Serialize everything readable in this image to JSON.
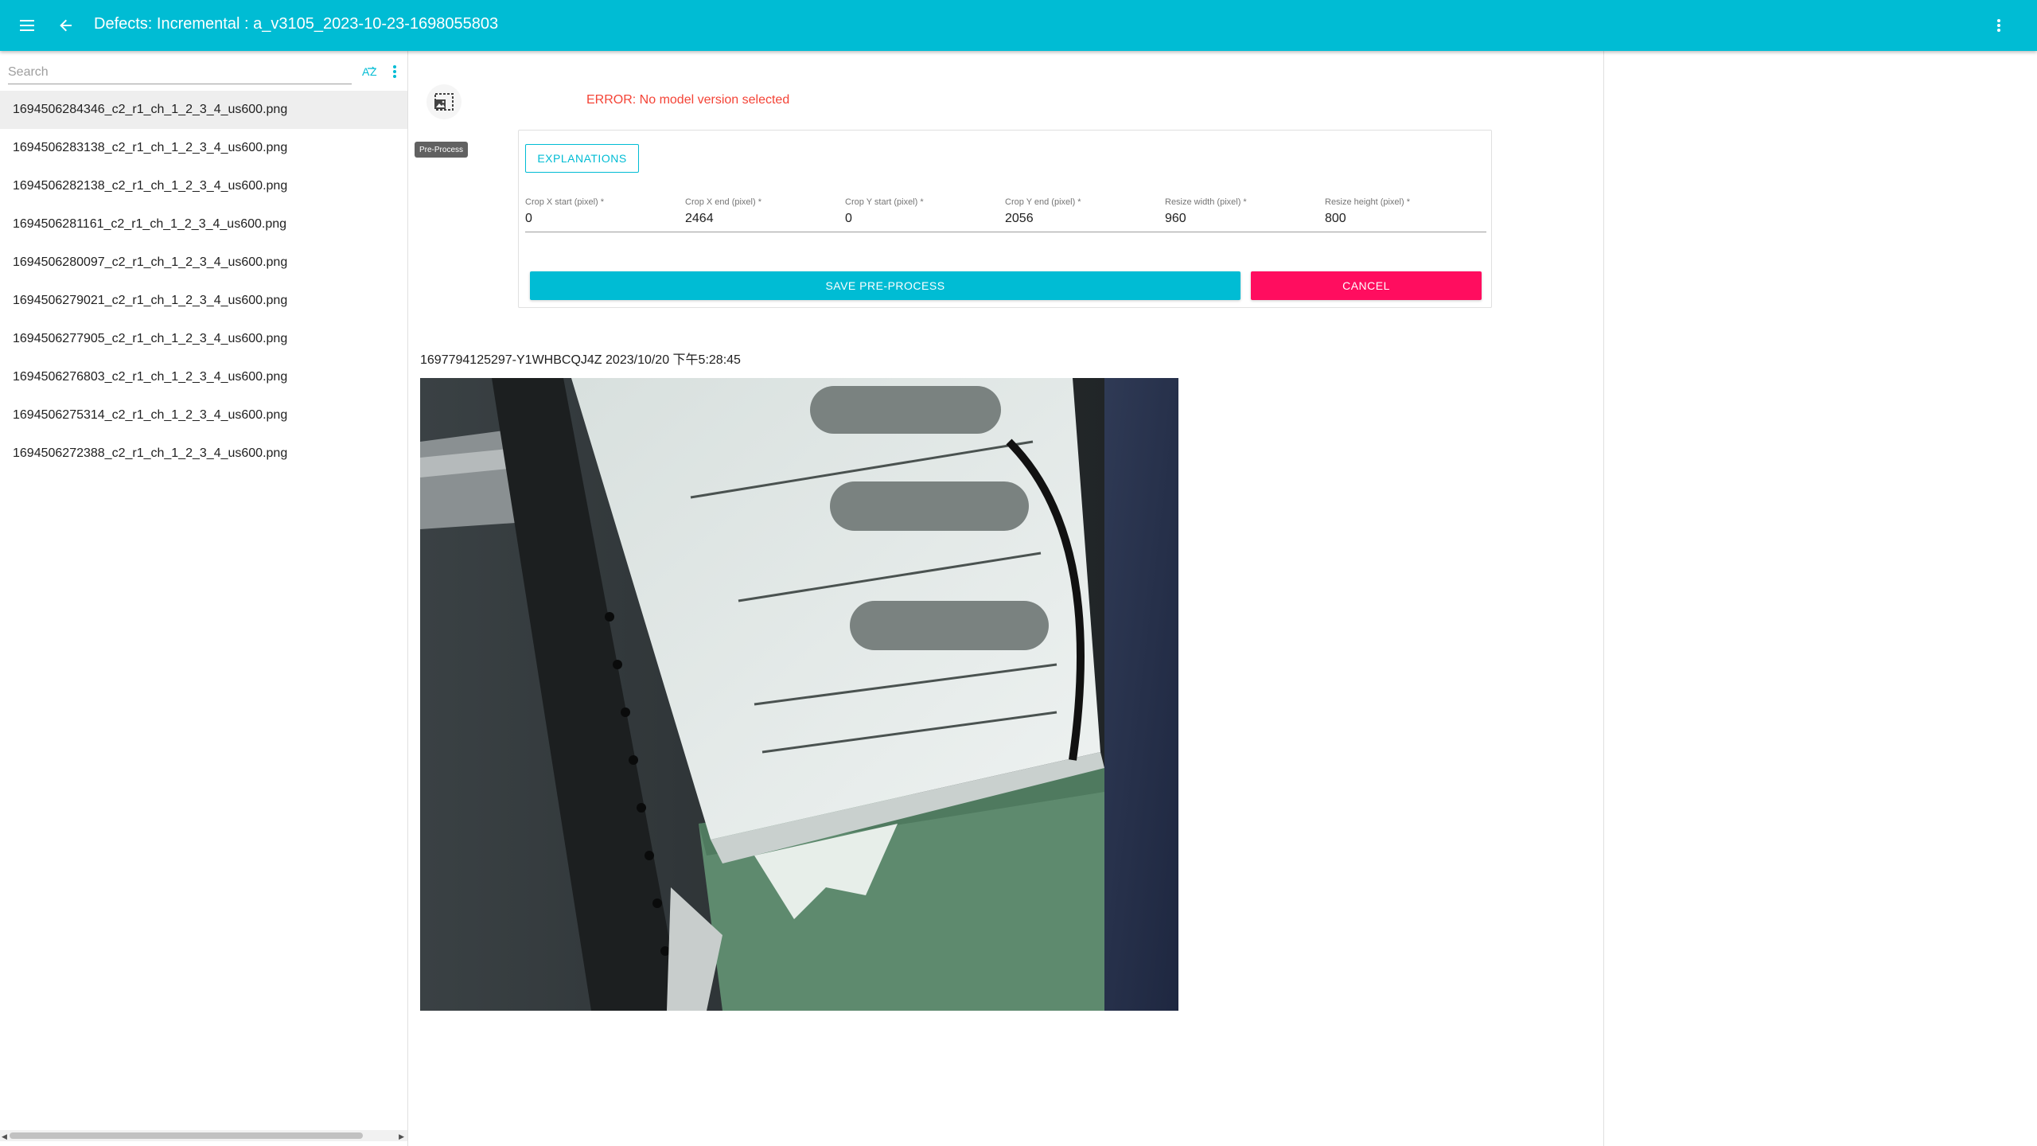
{
  "appbar": {
    "title": "Defects: Incremental : a_v3105_2023-10-23-1698055803",
    "menu_icon": "menu-icon",
    "back_icon": "arrow-back-icon",
    "more_icon": "more-vert-icon"
  },
  "sidebar": {
    "search_placeholder": "Search",
    "search_value": "",
    "sort_icon": "sort-az-icon",
    "files": [
      {
        "name": "1694506284346_c2_r1_ch_1_2_3_4_us600.png",
        "selected": true
      },
      {
        "name": "1694506283138_c2_r1_ch_1_2_3_4_us600.png",
        "selected": false
      },
      {
        "name": "1694506282138_c2_r1_ch_1_2_3_4_us600.png",
        "selected": false
      },
      {
        "name": "1694506281161_c2_r1_ch_1_2_3_4_us600.png",
        "selected": false
      },
      {
        "name": "1694506280097_c2_r1_ch_1_2_3_4_us600.png",
        "selected": false
      },
      {
        "name": "1694506279021_c2_r1_ch_1_2_3_4_us600.png",
        "selected": false
      },
      {
        "name": "1694506277905_c2_r1_ch_1_2_3_4_us600.png",
        "selected": false
      },
      {
        "name": "1694506276803_c2_r1_ch_1_2_3_4_us600.png",
        "selected": false
      },
      {
        "name": "1694506275314_c2_r1_ch_1_2_3_4_us600.png",
        "selected": false
      },
      {
        "name": "1694506272388_c2_r1_ch_1_2_3_4_us600.png",
        "selected": false
      }
    ]
  },
  "preprocess": {
    "icon": "image-crop-icon",
    "tooltip": "Pre-Process",
    "error": "ERROR: No model version selected",
    "explanations_label": "EXPLANATIONS",
    "fields": [
      {
        "label": "Crop X start (pixel) *",
        "value": "0"
      },
      {
        "label": "Crop X end (pixel) *",
        "value": "2464"
      },
      {
        "label": "Crop Y start (pixel) *",
        "value": "0"
      },
      {
        "label": "Crop Y end (pixel) *",
        "value": "2056"
      },
      {
        "label": "Resize width (pixel) *",
        "value": "960"
      },
      {
        "label": "Resize height (pixel) *",
        "value": "800"
      }
    ],
    "save_label": "SAVE PRE-PROCESS",
    "cancel_label": "CANCEL"
  },
  "image": {
    "caption": "1697794125297-Y1WHBCQJ4Z 2023/10/20 下午5:28:45"
  },
  "colors": {
    "primary": "#00bcd4",
    "accent": "#ff0d5f",
    "error": "#f44336"
  }
}
